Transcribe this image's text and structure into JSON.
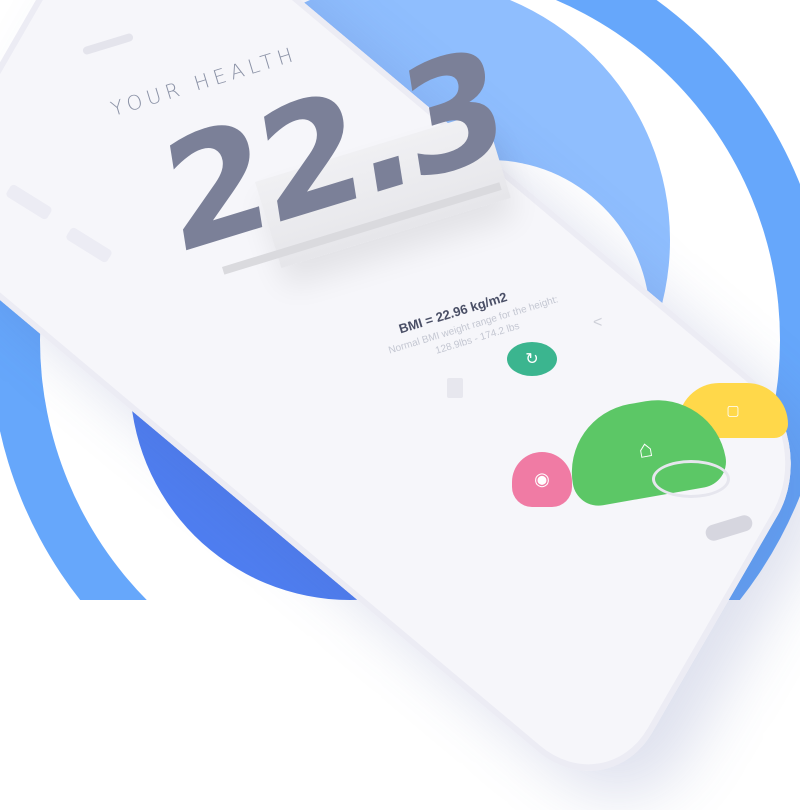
{
  "app": {
    "title": "YOUR HEALTH",
    "bmi_value": "22.3",
    "bmi_line": "BMI = 22.96 kg/m2",
    "note_line1": "Normal BMI weight range for the height:",
    "note_line2": "128.9lbs - 174.2 lbs"
  },
  "actions": {
    "refresh": "refresh-icon",
    "share": "share-icon",
    "delete": "trash-icon"
  },
  "tabs": [
    {
      "id": "profile",
      "icon": "user-icon",
      "color": "#f07ba4"
    },
    {
      "id": "home",
      "icon": "home-icon",
      "color": "#5cc766"
    },
    {
      "id": "chat",
      "icon": "chat-icon",
      "color": "#ffd84a"
    }
  ],
  "colors": {
    "bg_blue_dark": "#4f7ef0",
    "bg_blue_light": "#8fbefe",
    "accent_green": "#3bb58f",
    "text_dark": "#4a4f66"
  }
}
